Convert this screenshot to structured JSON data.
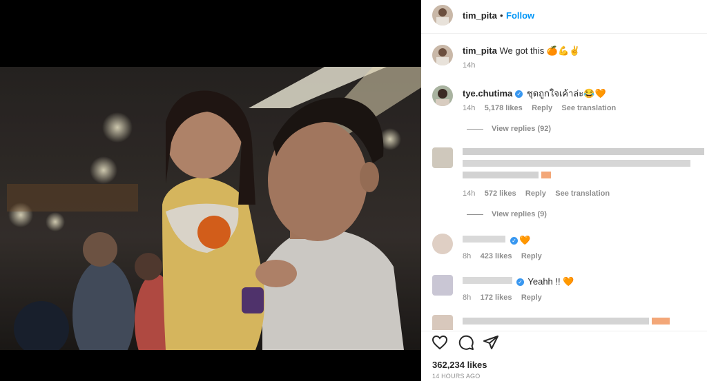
{
  "post": {
    "author": "tim_pita",
    "follow_label": "Follow",
    "dot": "•"
  },
  "caption": {
    "username": "tim_pita",
    "text": "We got this",
    "emojis": "🍊💪✌",
    "time": "14h"
  },
  "comments": [
    {
      "username": "tye.chutima",
      "verified": true,
      "text": "ชุดถูกใจเค้าล่ะ😂",
      "heart": "🧡",
      "time": "14h",
      "likes": "5,178 likes",
      "reply": "Reply",
      "translate": "See translation",
      "view_replies": "View replies (92)"
    },
    {
      "time": "14h",
      "likes": "572 likes",
      "reply": "Reply",
      "translate": "See translation",
      "view_replies": "View replies (9)"
    },
    {
      "heart": "🧡",
      "time": "8h",
      "likes": "423 likes",
      "reply": "Reply"
    },
    {
      "text": "Yeahh !!",
      "heart": "🧡",
      "time": "8h",
      "likes": "172 likes",
      "reply": "Reply"
    }
  ],
  "actions": {
    "like_icon": "heart-outline-icon",
    "comment_icon": "comment-icon",
    "share_icon": "paper-plane-icon"
  },
  "stats": {
    "likes": "362,234 likes",
    "posted": "14 HOURS AGO"
  },
  "colors": {
    "accent": "#0095f6",
    "verified": "#3897f0",
    "orange": "#f97316"
  }
}
